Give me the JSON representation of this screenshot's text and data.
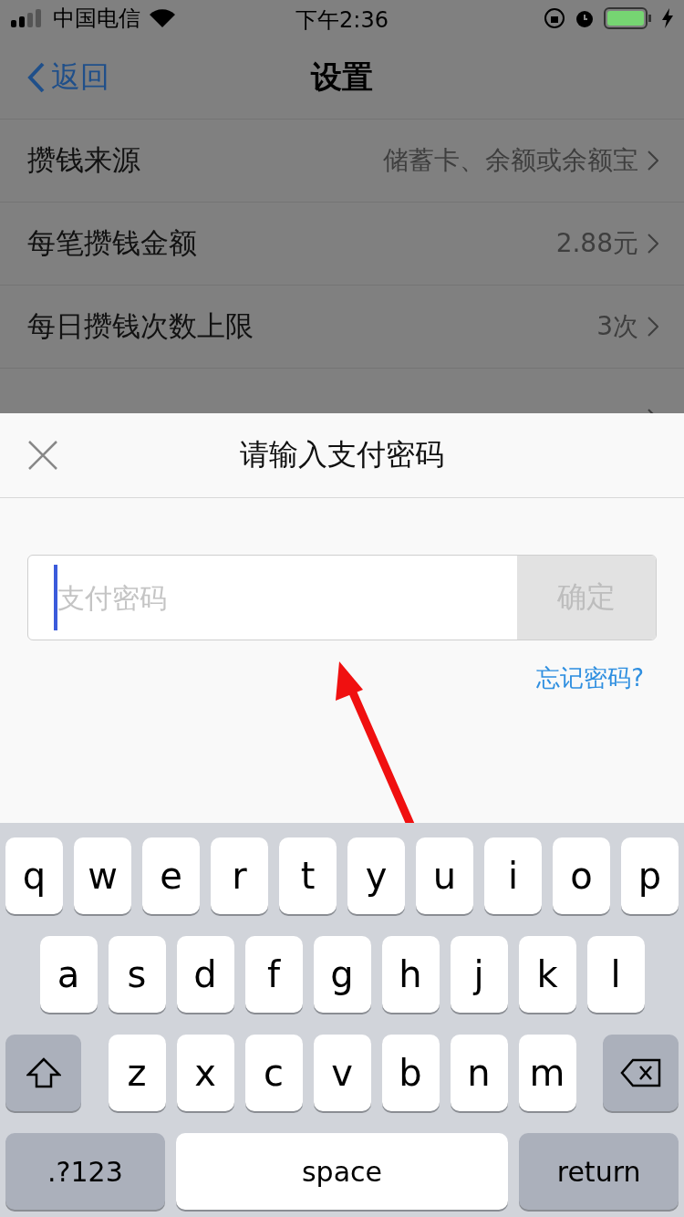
{
  "status_bar": {
    "carrier": "中国电信",
    "time": "下午2:36"
  },
  "nav": {
    "back": "返回",
    "title": "设置"
  },
  "settings": [
    {
      "label": "攒钱来源",
      "value": "储蓄卡、余额或余额宝"
    },
    {
      "label": "每笔攒钱金额",
      "value": "2.88元"
    },
    {
      "label": "每日攒钱次数上限",
      "value": "3次"
    }
  ],
  "dialog": {
    "title": "请输入支付密码",
    "password": {
      "placeholder": "支付密码"
    },
    "confirm": {
      "label": "确定",
      "disabled": true
    },
    "forgot": "忘记密码?"
  },
  "keyboard": {
    "rows": [
      [
        "q",
        "w",
        "e",
        "r",
        "t",
        "y",
        "u",
        "i",
        "o",
        "p"
      ],
      [
        "a",
        "s",
        "d",
        "f",
        "g",
        "h",
        "j",
        "k",
        "l"
      ],
      [
        "z",
        "x",
        "c",
        "v",
        "b",
        "n",
        "m"
      ]
    ],
    "numbers": ".?123",
    "space": "space",
    "return": "return"
  }
}
